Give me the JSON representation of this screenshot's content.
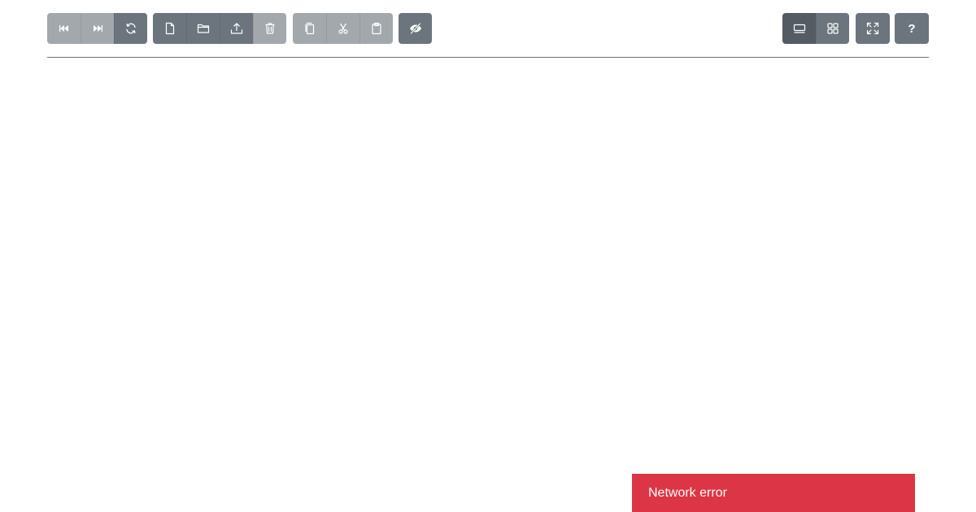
{
  "toolbar": {
    "navigation": {
      "back": {
        "icon": "skip-back-icon",
        "enabled": false
      },
      "forward": {
        "icon": "skip-forward-icon",
        "enabled": false
      },
      "refresh": {
        "icon": "refresh-icon",
        "enabled": true
      }
    },
    "file": {
      "new_file": {
        "icon": "new-file-icon",
        "enabled": true
      },
      "new_folder": {
        "icon": "folder-icon",
        "enabled": true
      },
      "upload": {
        "icon": "upload-icon",
        "enabled": true
      },
      "delete": {
        "icon": "trash-icon",
        "enabled": false
      }
    },
    "clipboard": {
      "copy": {
        "icon": "copy-icon",
        "enabled": false
      },
      "cut": {
        "icon": "scissors-icon",
        "enabled": false
      },
      "paste": {
        "icon": "paste-icon",
        "enabled": false
      }
    },
    "visibility": {
      "icon": "eye-off-icon",
      "enabled": true
    },
    "view_mode": {
      "list": {
        "icon": "list-view-icon",
        "active": true
      },
      "grid": {
        "icon": "grid-view-icon",
        "active": false
      }
    },
    "fullscreen": {
      "icon": "fullscreen-icon",
      "enabled": true
    },
    "help": {
      "icon": "help-icon",
      "label": "?"
    }
  },
  "notification": {
    "type": "error",
    "message": "Network error",
    "color": "#dc3545"
  },
  "colors": {
    "button": "#6c757d",
    "button_disabled": "#a3a8ad",
    "button_active": "#545b62"
  }
}
